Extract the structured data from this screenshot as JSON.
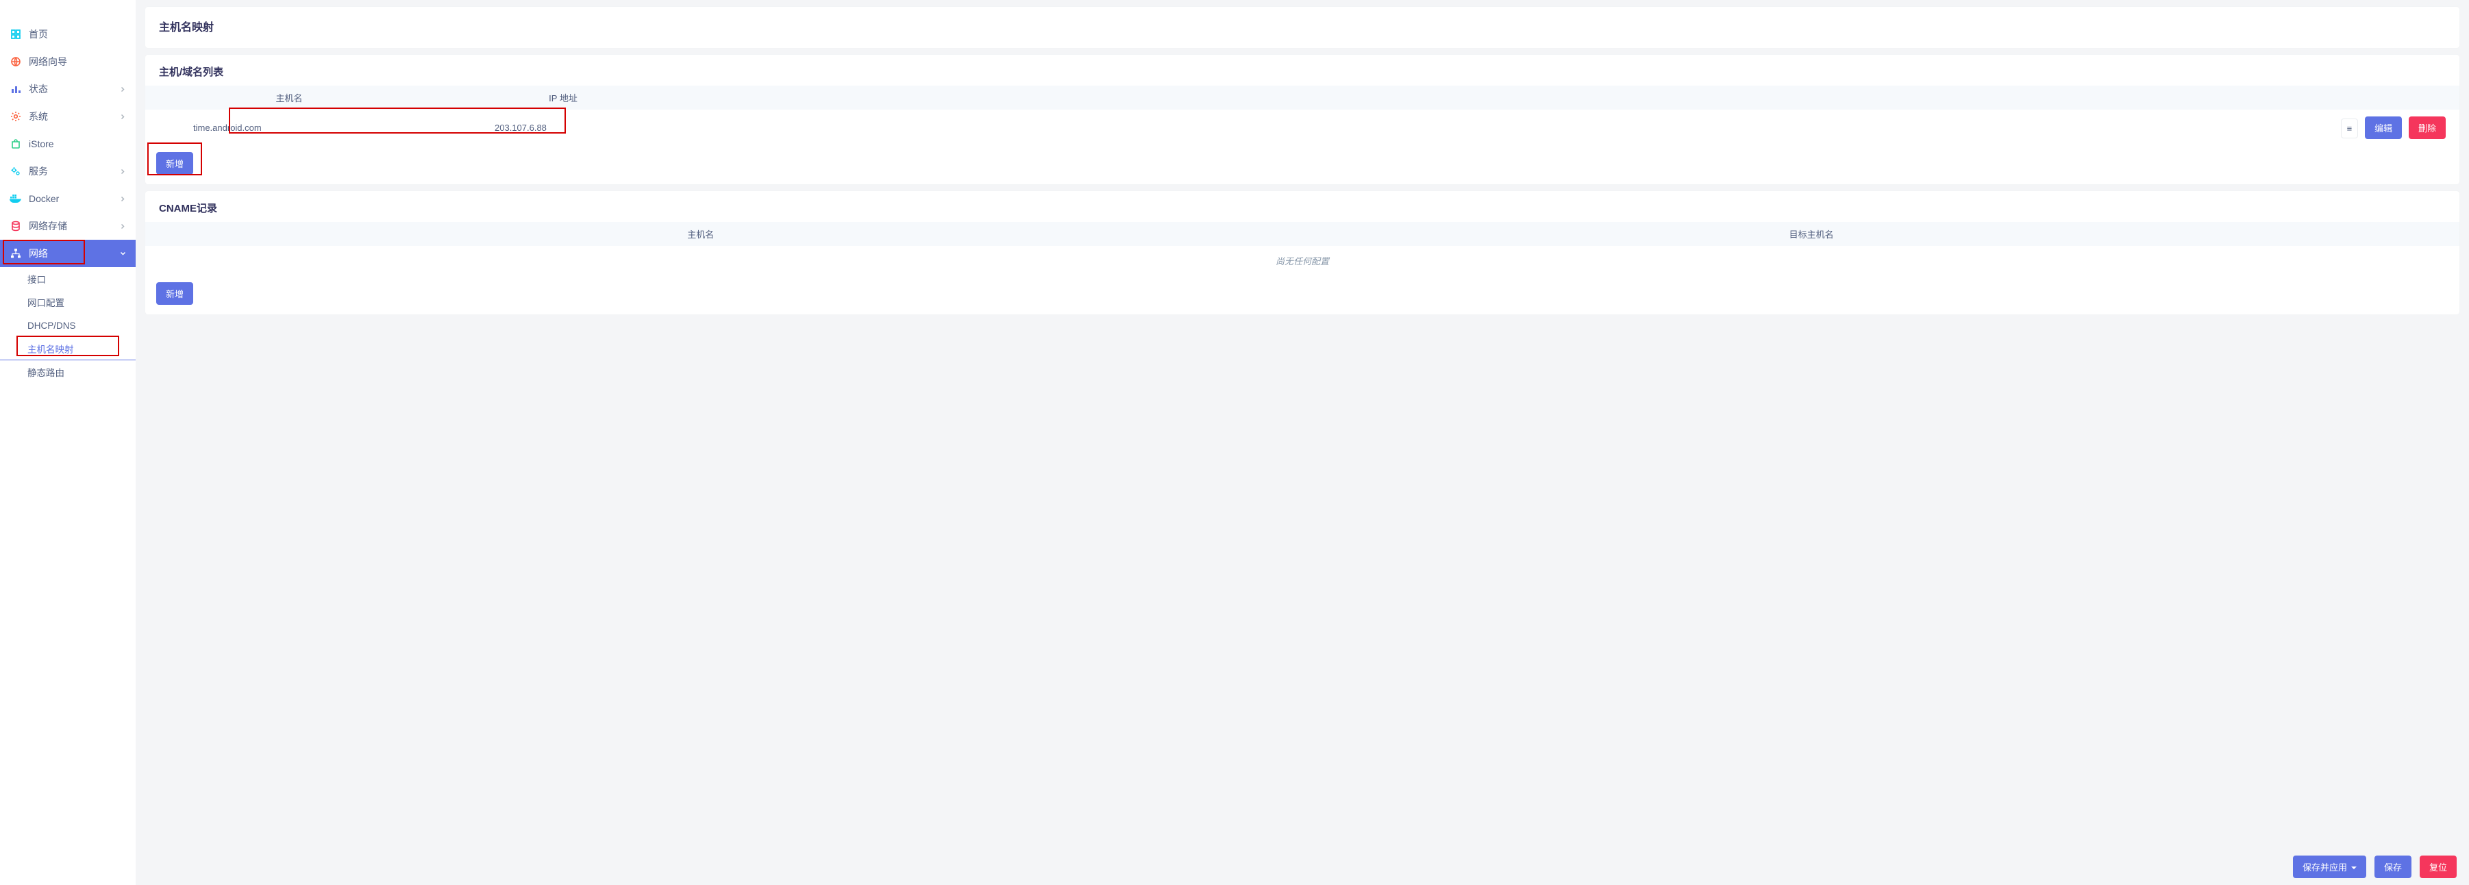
{
  "sidebar": {
    "items": [
      {
        "label": "首页",
        "icon": "home"
      },
      {
        "label": "网络向导",
        "icon": "wizard"
      },
      {
        "label": "状态",
        "icon": "status",
        "expandable": true
      },
      {
        "label": "系统",
        "icon": "system",
        "expandable": true
      },
      {
        "label": "iStore",
        "icon": "store"
      },
      {
        "label": "服务",
        "icon": "service",
        "expandable": true
      },
      {
        "label": "Docker",
        "icon": "docker",
        "expandable": true
      },
      {
        "label": "网络存储",
        "icon": "nas",
        "expandable": true
      },
      {
        "label": "网络",
        "icon": "network",
        "expandable": true,
        "active": true
      }
    ],
    "network_sub": [
      {
        "label": "接口"
      },
      {
        "label": "网口配置"
      },
      {
        "label": "DHCP/DNS"
      },
      {
        "label": "主机名映射",
        "current": true
      },
      {
        "label": "静态路由"
      }
    ]
  },
  "page": {
    "title": "主机名映射"
  },
  "hosts_panel": {
    "title": "主机/域名列表",
    "headers": {
      "host": "主机名",
      "ip": "IP 地址"
    },
    "rows": [
      {
        "host": "time.android.com",
        "ip": "203.107.6.88"
      }
    ],
    "row_actions": {
      "drag": "≡",
      "edit": "编辑",
      "delete": "删除"
    },
    "add": "新增"
  },
  "cname_panel": {
    "title": "CNAME记录",
    "headers": {
      "host": "主机名",
      "target": "目标主机名"
    },
    "empty": "尚无任何配置",
    "add": "新增"
  },
  "footer": {
    "save_apply": "保存并应用",
    "save": "保存",
    "reset": "复位"
  }
}
